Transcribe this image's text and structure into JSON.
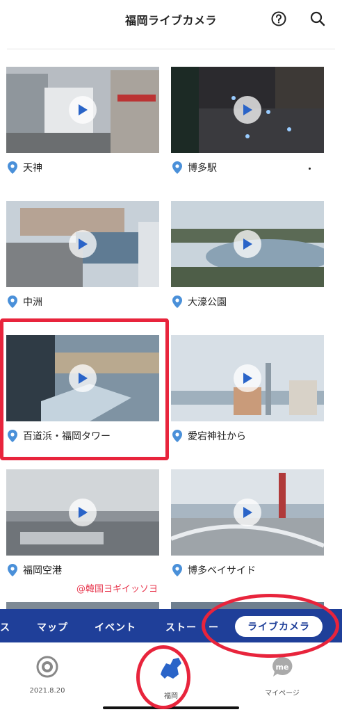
{
  "header": {
    "title": "福岡ライブカメラ",
    "help_icon": "help-circle-icon",
    "search_icon": "search-icon"
  },
  "cameras": [
    {
      "label": "天神"
    },
    {
      "label": "博多駅"
    },
    {
      "label": "中洲"
    },
    {
      "label": "大濠公園"
    },
    {
      "label": "百道浜・福岡タワー"
    },
    {
      "label": "愛宕神社から"
    },
    {
      "label": "福岡空港"
    },
    {
      "label": "博多ベイサイド"
    }
  ],
  "watermark": "@韓国ヨギイッソヨ",
  "tabs": [
    {
      "label": "ス"
    },
    {
      "label": "マップ"
    },
    {
      "label": "イベント"
    },
    {
      "label": "ストー"
    },
    {
      "label": "ー"
    },
    {
      "label": "ライブカメラ",
      "active": true
    }
  ],
  "bottom_nav": [
    {
      "label": "2021.8.20",
      "icon": "eye-icon"
    },
    {
      "label": "福岡",
      "icon": "fukuoka-map-icon",
      "active": true
    },
    {
      "label": "マイページ",
      "icon": "me-bubble-icon"
    }
  ],
  "colors": {
    "accent": "#1f3f99",
    "pin": "#4a90d9",
    "highlight": "#e8243c"
  }
}
